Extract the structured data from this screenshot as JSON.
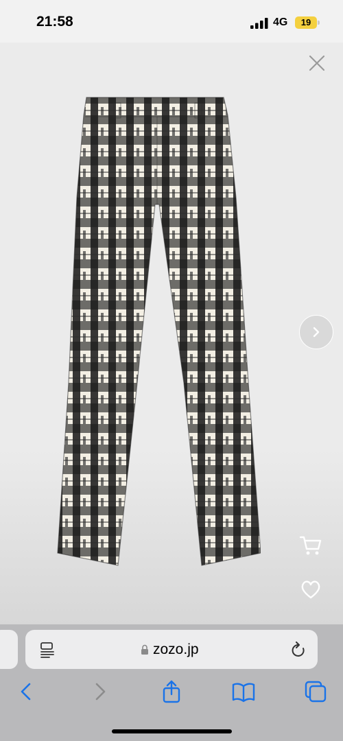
{
  "status_bar": {
    "time": "21:58",
    "network": "4G",
    "battery_level": "19",
    "battery_color": "#f4d03f"
  },
  "viewer": {
    "close_icon": "close-icon",
    "next_icon": "chevron-right-icon",
    "product_image": "black-and-white-plaid-wide-leg-trousers",
    "cart_icon": "cart-icon",
    "favorite_icon": "heart-icon"
  },
  "browser": {
    "url": "zozo.jp",
    "reader_icon": "reader-mode-icon",
    "lock_icon": "lock-icon",
    "reload_icon": "reload-icon",
    "accent_color": "#1a73e8",
    "toolbar": {
      "back_icon": "back-icon",
      "forward_icon": "forward-icon",
      "share_icon": "share-icon",
      "bookmarks_icon": "bookmarks-icon",
      "tabs_icon": "tabs-icon"
    }
  }
}
